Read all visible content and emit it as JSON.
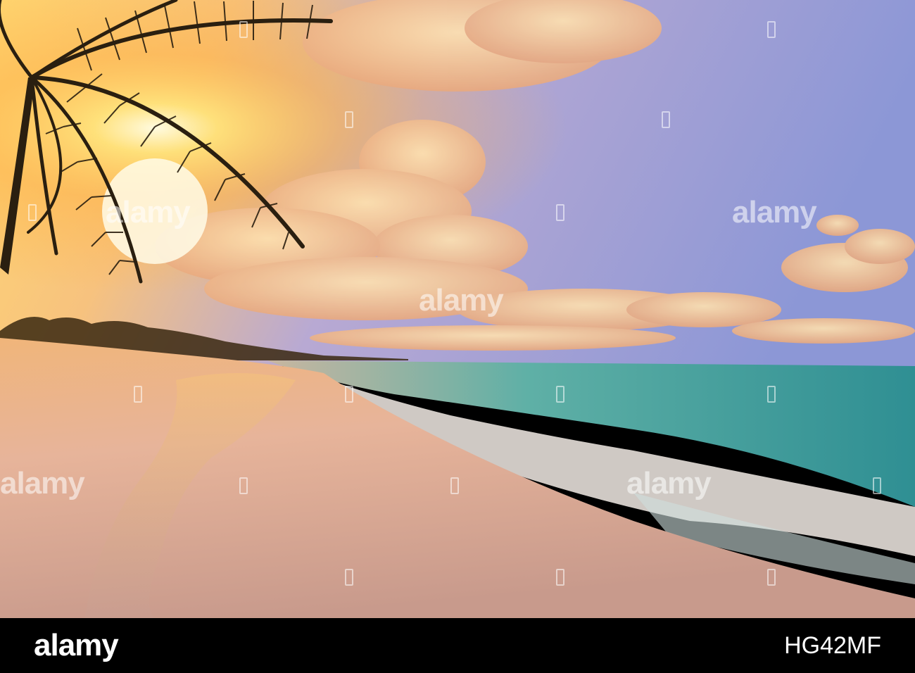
{
  "photo": {
    "subject": "tropical beach at sunrise with palm trees",
    "colors": {
      "sky_top": "#9aa3d6",
      "sky_mid": "#c9a9c8",
      "sun": "#fff4b0",
      "sun_glow": "#ffb347",
      "cloud": "#f6c99a",
      "sea": "#4faaa0",
      "foam": "#f3ece6",
      "sand": "#e9b894",
      "wet_sand": "#d9a58c",
      "palm": "#2a1f10"
    }
  },
  "watermark": {
    "text": "alamy"
  },
  "footer": {
    "logo": "alamy",
    "image_id": "HG42MF"
  }
}
